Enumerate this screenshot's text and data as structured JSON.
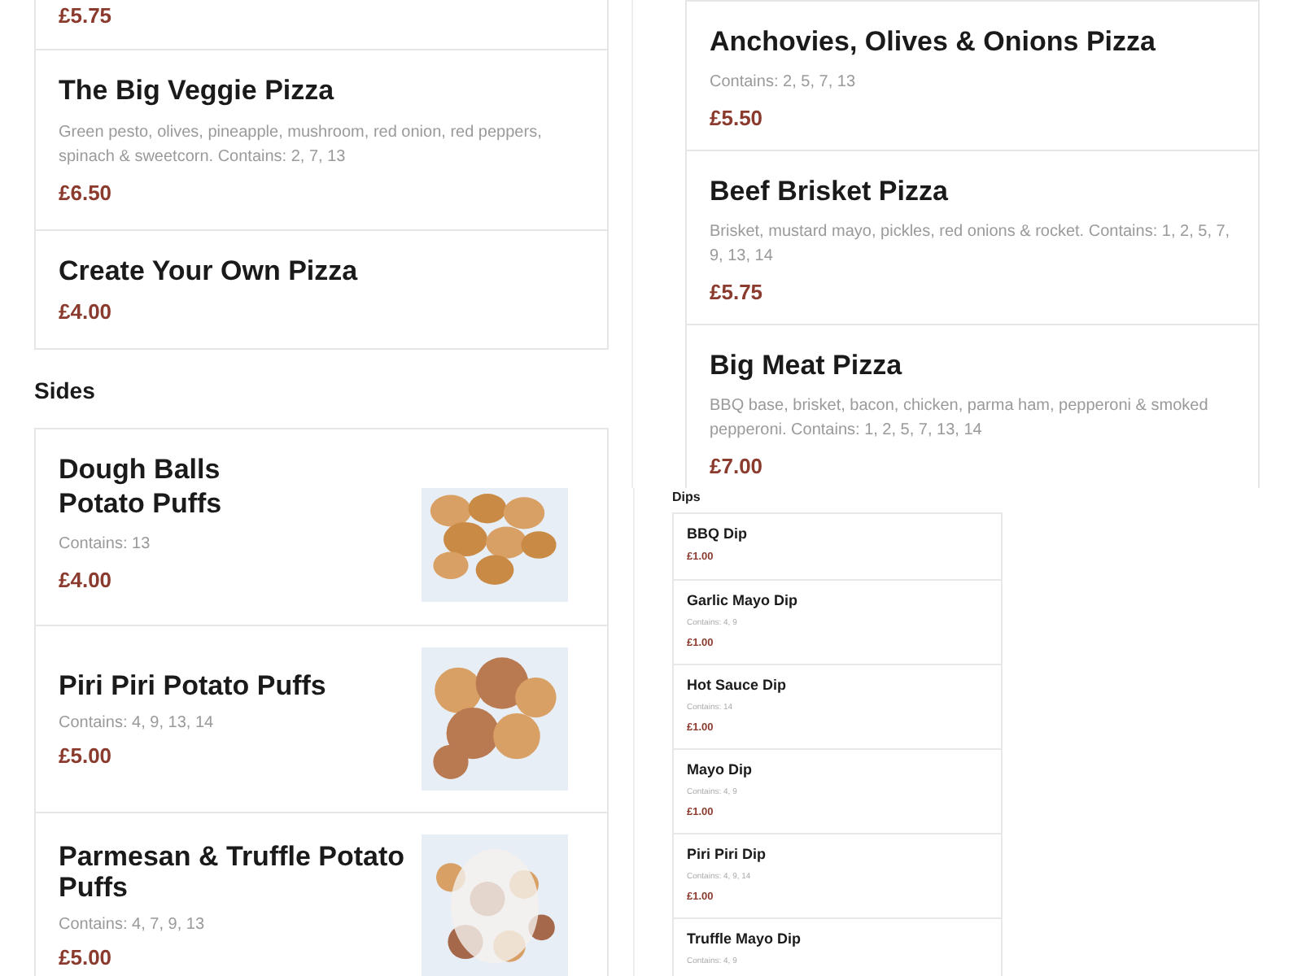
{
  "pizzas_left": [
    {
      "price": "£5.75"
    },
    {
      "name": "The Big Veggie Pizza",
      "description": "Green pesto, olives, pineapple, mushroom, red onion, red peppers, spinach & sweetcorn. Contains: 2, 7, 13",
      "price": "£6.50"
    },
    {
      "name": "Create Your Own Pizza",
      "price": "£4.00"
    }
  ],
  "sides_heading": "Sides",
  "sides_top": [
    {
      "name": "Dough Balls"
    }
  ],
  "pizzas_right": [
    {
      "name": "Anchovies, Olives & Onions Pizza",
      "description": "Contains: 2, 5, 7, 13",
      "price": "£5.50"
    },
    {
      "name": "Beef Brisket Pizza",
      "description": "Brisket, mustard mayo, pickles, red onions & rocket. Contains: 1, 2, 5, 7, 9, 13, 14",
      "price": "£5.75"
    },
    {
      "name": "Big Meat Pizza",
      "description": "BBQ base, brisket, bacon, chicken, parma ham, pepperoni & smoked pepperoni. Contains: 1, 2, 5, 7, 13, 14",
      "price": "£7.00"
    }
  ],
  "sides": [
    {
      "name": "Potato Puffs",
      "description": "Contains: 13",
      "price": "£4.00"
    },
    {
      "name": "Piri Piri Potato Puffs",
      "description": "Contains: 4, 9, 13, 14",
      "price": "£5.00"
    },
    {
      "name": "Parmesan & Truffle Potato Puffs",
      "description": "Contains: 4, 7, 9, 13",
      "price": "£5.00"
    }
  ],
  "dips": {
    "heading": "Dips",
    "items": [
      {
        "name": "BBQ Dip",
        "price": "£1.00"
      },
      {
        "name": "Garlic Mayo Dip",
        "description": "Contains: 4, 9",
        "price": "£1.00"
      },
      {
        "name": "Hot Sauce Dip",
        "description": "Contains: 14",
        "price": "£1.00"
      },
      {
        "name": "Mayo Dip",
        "description": "Contains: 4, 9",
        "price": "£1.00"
      },
      {
        "name": "Piri Piri Dip",
        "description": "Contains: 4, 9, 14",
        "price": "£1.00"
      },
      {
        "name": "Truffle Mayo Dip",
        "description": "Contains: 4, 9"
      }
    ]
  }
}
